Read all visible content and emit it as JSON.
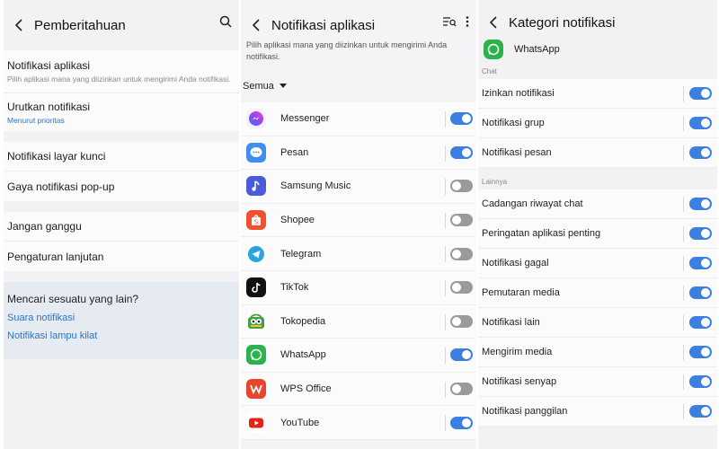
{
  "panel1": {
    "title": "Pemberitahuan",
    "groups": [
      [
        {
          "label": "Notifikasi aplikasi",
          "sub": "Pilih aplikasi mana yang diizinkan untuk mengirimi Anda notifikasi.",
          "h": 48
        },
        {
          "label": "Urutkan notifikasi",
          "link": "Menurut prioritas",
          "h": 42
        }
      ],
      [
        {
          "label": "Notifikasi layar kunci",
          "h": 33
        },
        {
          "label": "Gaya notifikasi pop-up",
          "h": 33
        }
      ],
      [
        {
          "label": "Jangan ganggu",
          "h": 33
        },
        {
          "label": "Pengaturan lanjutan",
          "h": 33
        }
      ]
    ],
    "suggest": {
      "title": "Mencari sesuatu yang lain?",
      "links": [
        "Suara notifikasi",
        "Notifikasi lampu kilat"
      ]
    }
  },
  "panel2": {
    "title": "Notifikasi aplikasi",
    "description": "Pilih aplikasi mana yang diizinkan untuk mengirimi Anda notifikasi.",
    "filter": "Semua",
    "apps": [
      {
        "name": "Messenger",
        "on": true,
        "icon": "messenger-icon",
        "color": "#f3f0ff"
      },
      {
        "name": "Pesan",
        "on": true,
        "icon": "messages-icon",
        "color": "#3d8ef0"
      },
      {
        "name": "Samsung Music",
        "on": false,
        "icon": "music-icon",
        "color": "#4b5bdb"
      },
      {
        "name": "Shopee",
        "on": false,
        "icon": "shopee-icon",
        "color": "#f0522d"
      },
      {
        "name": "Telegram",
        "on": false,
        "icon": "telegram-icon",
        "color": "#ffffff"
      },
      {
        "name": "TikTok",
        "on": false,
        "icon": "tiktok-icon",
        "color": "#111111"
      },
      {
        "name": "Tokopedia",
        "on": false,
        "icon": "tokopedia-icon",
        "color": "#ffffff"
      },
      {
        "name": "WhatsApp",
        "on": true,
        "icon": "whatsapp-icon",
        "color": "#2bb24c"
      },
      {
        "name": "WPS Office",
        "on": false,
        "icon": "wps-icon",
        "color": "#e8452c"
      },
      {
        "name": "YouTube",
        "on": true,
        "icon": "youtube-icon",
        "color": "#ffffff"
      }
    ]
  },
  "panel3": {
    "title": "Kategori notifikasi",
    "app": "WhatsApp",
    "sections": [
      {
        "label": "Chat",
        "items": [
          "Izinkan notifikasi",
          "Notifikasi grup",
          "Notifikasi pesan"
        ]
      },
      {
        "label": "Lainnya",
        "items": [
          "Cadangan riwayat chat",
          "Peringatan aplikasi penting",
          "Notifikasi gagal",
          "Pemutaran media",
          "Notifikasi lain",
          "Mengirim media",
          "Notifikasi senyap",
          "Notifikasi panggilan"
        ]
      }
    ]
  },
  "colors": {
    "accent": "#3b7fe0",
    "link": "#2a74c9",
    "toggle_off": "#9a9a9a"
  }
}
